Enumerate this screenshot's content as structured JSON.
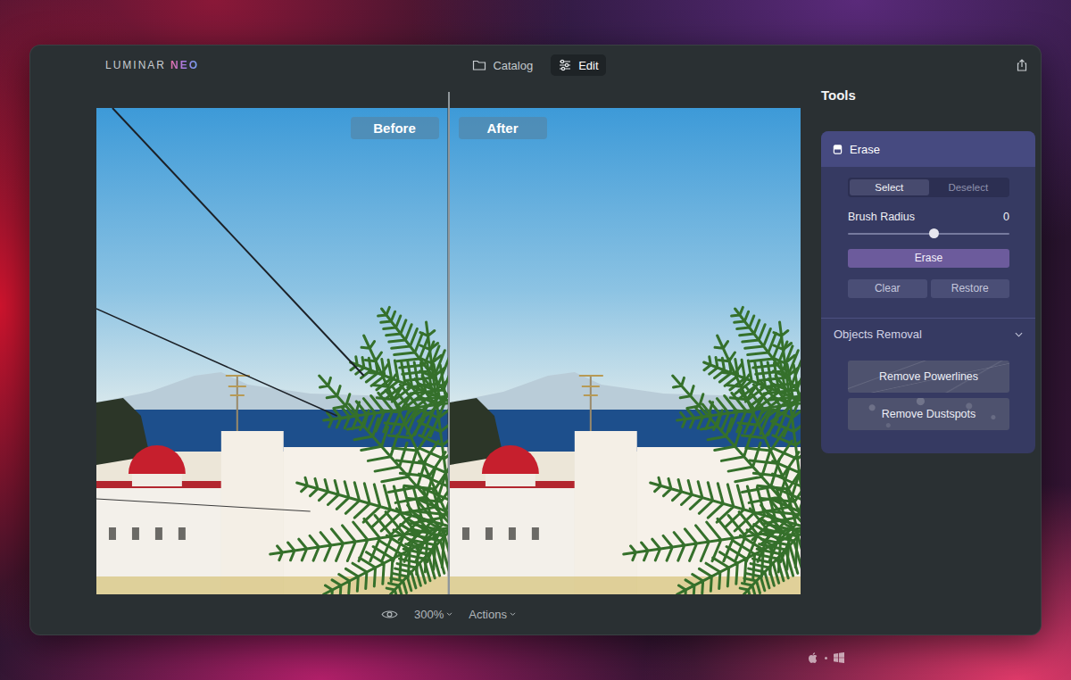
{
  "app": {
    "logo": {
      "brand": "LUMINAR",
      "product": "NEO"
    }
  },
  "nav_tabs": [
    {
      "label": "Catalog",
      "selected": false
    },
    {
      "label": "Edit",
      "selected": true
    }
  ],
  "compare": {
    "before_label": "Before",
    "after_label": "After"
  },
  "bottom_bar": {
    "zoom": "300%",
    "actions": "Actions"
  },
  "tools": {
    "title": "Tools",
    "panel": {
      "title": "Erase",
      "expanded": true,
      "modes": [
        {
          "label": "Select",
          "selected": true
        },
        {
          "label": "Deselect",
          "selected": false
        }
      ],
      "brush_radius": {
        "label": "Brush Radius",
        "reading": "0",
        "level": 0.53
      },
      "primary_button": "Erase",
      "secondary_buttons": [
        "Clear",
        "Restore"
      ],
      "section": {
        "title": "Objects Removal",
        "expanded": true,
        "buttons": [
          {
            "label": "Remove Powerlines",
            "kind": "lines"
          },
          {
            "label": "Remove Dustspots",
            "kind": "dots"
          }
        ]
      }
    }
  }
}
